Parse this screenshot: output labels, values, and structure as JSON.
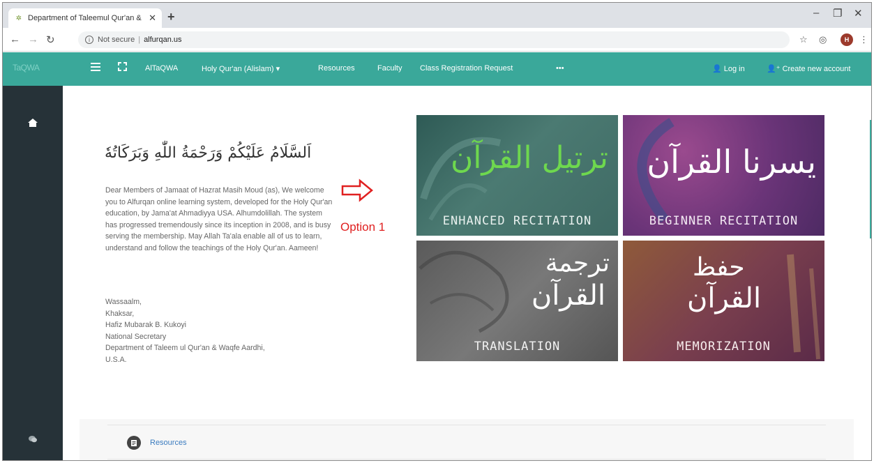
{
  "browser": {
    "tab_title": "Department of Taleemul Qur'an &",
    "tab_close": "✕",
    "new_tab": "+",
    "win_minimize": "–",
    "win_maximize": "❐",
    "win_close": "✕",
    "security_label": "Not secure",
    "url": "alfurqan.us",
    "profile_initial": "H"
  },
  "navbar": {
    "brand": "TaQWA",
    "items": [
      "AlTaQWA",
      "Holy Qur'an (Alislam)",
      "Resources",
      "Faculty",
      "Class Registration Request",
      "•••"
    ],
    "login": "Log in",
    "create_account": "Create new account"
  },
  "main": {
    "greeting_arabic": "اَلسَّلَامُ عَلَيْكُمْ وَرَحْمَةُ اللّٰهِ وَبَرَكَاتُهٗ",
    "welcome_text": "Dear Members of Jamaat of Hazrat Masih Moud (as), We welcome you to Alfurqan online learning system, developed for the Holy Qur'an education, by Jama'at Ahmadiyya USA. Alhumdolillah. The system has progressed tremendously since its inception in 2008, and is busy serving the membership. May Allah Ta'ala enable all of us to learn, understand and follow the teachings of the Holy Qur'an. Aameen!",
    "signoff": [
      "Wassaalm,",
      "Khaksar,",
      "Hafiz Mubarak B. Kukoyi",
      "National Secretary",
      "Department of Taleem ul Qur'an & Waqfe Aardhi,",
      "U.S.A."
    ],
    "option_label": "Option 1"
  },
  "tiles": [
    {
      "arabic": "ترتيل القرآن",
      "english": "ENHANCED RECITATION"
    },
    {
      "arabic": "يسرنا القرآن",
      "english": "BEGINNER RECITATION"
    },
    {
      "arabic_line1": "ترجمة",
      "arabic_line2": "القرآن",
      "english": "TRANSLATION"
    },
    {
      "arabic_line1": "حفظ",
      "arabic_line2": "القرآن",
      "english": "MEMORIZATION"
    }
  ],
  "resources": {
    "link": "Resources"
  },
  "colors": {
    "accent": "#3aa89a",
    "drawer": "#263238",
    "option": "#e02020"
  }
}
